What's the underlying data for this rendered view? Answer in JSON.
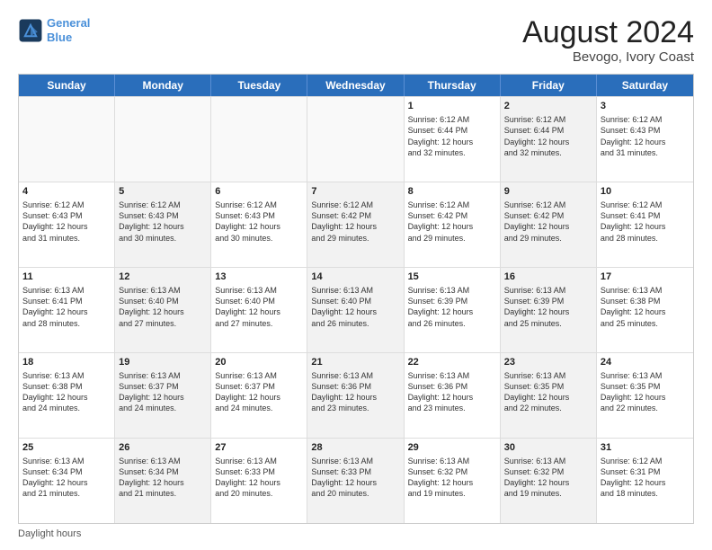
{
  "header": {
    "logo_line1": "General",
    "logo_line2": "Blue",
    "month_title": "August 2024",
    "location": "Bevogo, Ivory Coast"
  },
  "days_of_week": [
    "Sunday",
    "Monday",
    "Tuesday",
    "Wednesday",
    "Thursday",
    "Friday",
    "Saturday"
  ],
  "footer_note": "Daylight hours",
  "weeks": [
    [
      {
        "day": "",
        "text": "",
        "shaded": false,
        "empty": true
      },
      {
        "day": "",
        "text": "",
        "shaded": false,
        "empty": true
      },
      {
        "day": "",
        "text": "",
        "shaded": false,
        "empty": true
      },
      {
        "day": "",
        "text": "",
        "shaded": false,
        "empty": true
      },
      {
        "day": "1",
        "text": "Sunrise: 6:12 AM\nSunset: 6:44 PM\nDaylight: 12 hours\nand 32 minutes.",
        "shaded": false,
        "empty": false
      },
      {
        "day": "2",
        "text": "Sunrise: 6:12 AM\nSunset: 6:44 PM\nDaylight: 12 hours\nand 32 minutes.",
        "shaded": true,
        "empty": false
      },
      {
        "day": "3",
        "text": "Sunrise: 6:12 AM\nSunset: 6:43 PM\nDaylight: 12 hours\nand 31 minutes.",
        "shaded": false,
        "empty": false
      }
    ],
    [
      {
        "day": "4",
        "text": "Sunrise: 6:12 AM\nSunset: 6:43 PM\nDaylight: 12 hours\nand 31 minutes.",
        "shaded": false,
        "empty": false
      },
      {
        "day": "5",
        "text": "Sunrise: 6:12 AM\nSunset: 6:43 PM\nDaylight: 12 hours\nand 30 minutes.",
        "shaded": true,
        "empty": false
      },
      {
        "day": "6",
        "text": "Sunrise: 6:12 AM\nSunset: 6:43 PM\nDaylight: 12 hours\nand 30 minutes.",
        "shaded": false,
        "empty": false
      },
      {
        "day": "7",
        "text": "Sunrise: 6:12 AM\nSunset: 6:42 PM\nDaylight: 12 hours\nand 29 minutes.",
        "shaded": true,
        "empty": false
      },
      {
        "day": "8",
        "text": "Sunrise: 6:12 AM\nSunset: 6:42 PM\nDaylight: 12 hours\nand 29 minutes.",
        "shaded": false,
        "empty": false
      },
      {
        "day": "9",
        "text": "Sunrise: 6:12 AM\nSunset: 6:42 PM\nDaylight: 12 hours\nand 29 minutes.",
        "shaded": true,
        "empty": false
      },
      {
        "day": "10",
        "text": "Sunrise: 6:12 AM\nSunset: 6:41 PM\nDaylight: 12 hours\nand 28 minutes.",
        "shaded": false,
        "empty": false
      }
    ],
    [
      {
        "day": "11",
        "text": "Sunrise: 6:13 AM\nSunset: 6:41 PM\nDaylight: 12 hours\nand 28 minutes.",
        "shaded": false,
        "empty": false
      },
      {
        "day": "12",
        "text": "Sunrise: 6:13 AM\nSunset: 6:40 PM\nDaylight: 12 hours\nand 27 minutes.",
        "shaded": true,
        "empty": false
      },
      {
        "day": "13",
        "text": "Sunrise: 6:13 AM\nSunset: 6:40 PM\nDaylight: 12 hours\nand 27 minutes.",
        "shaded": false,
        "empty": false
      },
      {
        "day": "14",
        "text": "Sunrise: 6:13 AM\nSunset: 6:40 PM\nDaylight: 12 hours\nand 26 minutes.",
        "shaded": true,
        "empty": false
      },
      {
        "day": "15",
        "text": "Sunrise: 6:13 AM\nSunset: 6:39 PM\nDaylight: 12 hours\nand 26 minutes.",
        "shaded": false,
        "empty": false
      },
      {
        "day": "16",
        "text": "Sunrise: 6:13 AM\nSunset: 6:39 PM\nDaylight: 12 hours\nand 25 minutes.",
        "shaded": true,
        "empty": false
      },
      {
        "day": "17",
        "text": "Sunrise: 6:13 AM\nSunset: 6:38 PM\nDaylight: 12 hours\nand 25 minutes.",
        "shaded": false,
        "empty": false
      }
    ],
    [
      {
        "day": "18",
        "text": "Sunrise: 6:13 AM\nSunset: 6:38 PM\nDaylight: 12 hours\nand 24 minutes.",
        "shaded": false,
        "empty": false
      },
      {
        "day": "19",
        "text": "Sunrise: 6:13 AM\nSunset: 6:37 PM\nDaylight: 12 hours\nand 24 minutes.",
        "shaded": true,
        "empty": false
      },
      {
        "day": "20",
        "text": "Sunrise: 6:13 AM\nSunset: 6:37 PM\nDaylight: 12 hours\nand 24 minutes.",
        "shaded": false,
        "empty": false
      },
      {
        "day": "21",
        "text": "Sunrise: 6:13 AM\nSunset: 6:36 PM\nDaylight: 12 hours\nand 23 minutes.",
        "shaded": true,
        "empty": false
      },
      {
        "day": "22",
        "text": "Sunrise: 6:13 AM\nSunset: 6:36 PM\nDaylight: 12 hours\nand 23 minutes.",
        "shaded": false,
        "empty": false
      },
      {
        "day": "23",
        "text": "Sunrise: 6:13 AM\nSunset: 6:35 PM\nDaylight: 12 hours\nand 22 minutes.",
        "shaded": true,
        "empty": false
      },
      {
        "day": "24",
        "text": "Sunrise: 6:13 AM\nSunset: 6:35 PM\nDaylight: 12 hours\nand 22 minutes.",
        "shaded": false,
        "empty": false
      }
    ],
    [
      {
        "day": "25",
        "text": "Sunrise: 6:13 AM\nSunset: 6:34 PM\nDaylight: 12 hours\nand 21 minutes.",
        "shaded": false,
        "empty": false
      },
      {
        "day": "26",
        "text": "Sunrise: 6:13 AM\nSunset: 6:34 PM\nDaylight: 12 hours\nand 21 minutes.",
        "shaded": true,
        "empty": false
      },
      {
        "day": "27",
        "text": "Sunrise: 6:13 AM\nSunset: 6:33 PM\nDaylight: 12 hours\nand 20 minutes.",
        "shaded": false,
        "empty": false
      },
      {
        "day": "28",
        "text": "Sunrise: 6:13 AM\nSunset: 6:33 PM\nDaylight: 12 hours\nand 20 minutes.",
        "shaded": true,
        "empty": false
      },
      {
        "day": "29",
        "text": "Sunrise: 6:13 AM\nSunset: 6:32 PM\nDaylight: 12 hours\nand 19 minutes.",
        "shaded": false,
        "empty": false
      },
      {
        "day": "30",
        "text": "Sunrise: 6:13 AM\nSunset: 6:32 PM\nDaylight: 12 hours\nand 19 minutes.",
        "shaded": true,
        "empty": false
      },
      {
        "day": "31",
        "text": "Sunrise: 6:12 AM\nSunset: 6:31 PM\nDaylight: 12 hours\nand 18 minutes.",
        "shaded": false,
        "empty": false
      }
    ]
  ]
}
